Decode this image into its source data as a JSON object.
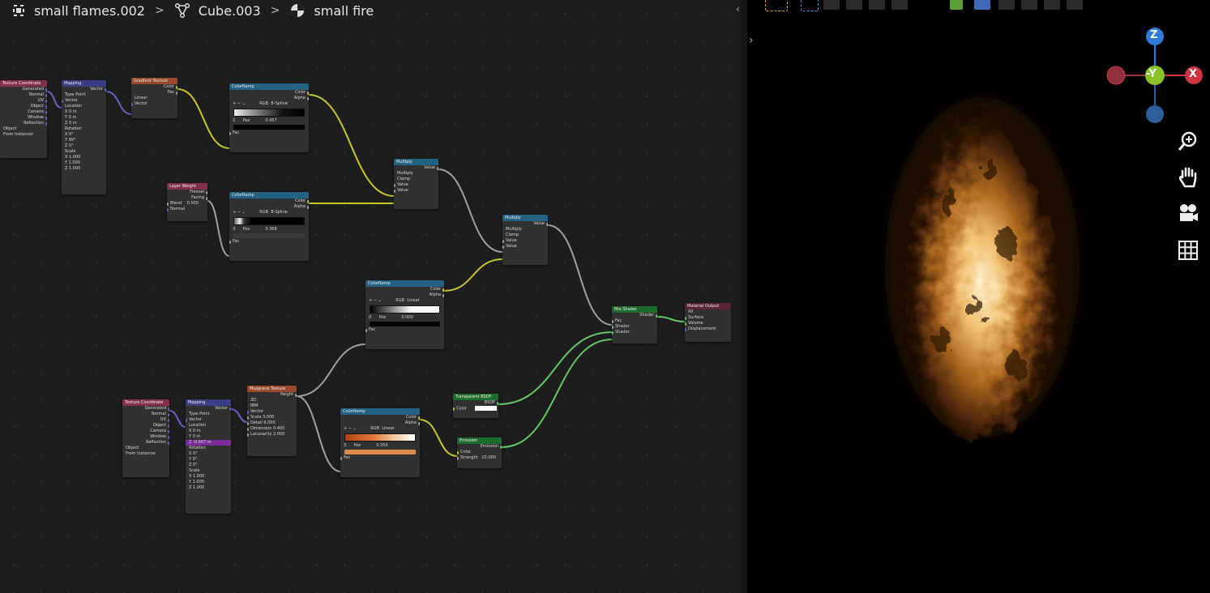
{
  "breadcrumbs": {
    "object": "small flames.002",
    "mesh": "Cube.003",
    "material": "small fire"
  },
  "nodes": {
    "tc1": {
      "title": "Texture Coordinate",
      "outs": [
        "Generated",
        "Normal",
        "UV",
        "Object",
        "Camera",
        "Window",
        "Reflection"
      ],
      "object": "Object",
      "from_instancer": "From Instancer"
    },
    "map1": {
      "title": "Mapping",
      "out": "Vector",
      "type_label": "Type",
      "type_val": "Point",
      "vec": "Vector",
      "loc": "Location",
      "loc_vals": [
        "X 0 m",
        "Y 0 m",
        "Z 0 m"
      ],
      "rot": "Rotation",
      "rot_vals": [
        "X 0°",
        "Y 90°",
        "Z 0°"
      ],
      "scale": "Scale",
      "scale_vals": [
        "X 1.000",
        "Y 1.000",
        "Z 1.000"
      ]
    },
    "grad": {
      "title": "Gradient Texture",
      "outs": [
        "Color",
        "Fac"
      ],
      "mode": "Linear",
      "in": "Vector"
    },
    "cr1": {
      "title": "ColorRamp",
      "outs": [
        "Color",
        "Alpha"
      ],
      "mode": "RGB",
      "interp": "B-Spline",
      "idx": "2",
      "pos_label": "Pos",
      "pos_val": "0.457",
      "in": "Fac"
    },
    "lw": {
      "title": "Layer Weight",
      "outs": [
        "Fresnel",
        "Facing"
      ],
      "blend": "Blend",
      "blend_val": "0.500",
      "in": "Normal"
    },
    "cr2": {
      "title": "ColorRamp",
      "outs": [
        "Color",
        "Alpha"
      ],
      "mode": "RGB",
      "interp": "B-Spline",
      "idx": "3",
      "pos_label": "Pos",
      "pos_val": "0.368",
      "in": "Fac"
    },
    "mul1": {
      "title": "Multiply",
      "out": "Value",
      "op": "Multiply",
      "clamp": "Clamp",
      "ins": [
        "Value",
        "Value"
      ]
    },
    "mul2": {
      "title": "Multiply",
      "out": "Value",
      "op": "Multiply",
      "clamp": "Clamp",
      "ins": [
        "Value",
        "Value"
      ]
    },
    "cr3": {
      "title": "ColorRamp",
      "outs": [
        "Color",
        "Alpha"
      ],
      "mode": "RGB",
      "interp": "Linear",
      "idx": "0",
      "pos_label": "Pos",
      "pos_val": "0.000",
      "in": "Fac"
    },
    "mix": {
      "title": "Mix Shader",
      "out": "Shader",
      "ins": [
        "Fac",
        "Shader",
        "Shader"
      ]
    },
    "out": {
      "title": "Material Output",
      "target": "All",
      "ins": [
        "Surface",
        "Volume",
        "Displacement"
      ]
    },
    "tc2": {
      "title": "Texture Coordinate",
      "outs": [
        "Generated",
        "Normal",
        "UV",
        "Object",
        "Camera",
        "Window",
        "Reflection"
      ],
      "object": "Object",
      "from_instancer": "From Instancer"
    },
    "map2": {
      "title": "Mapping",
      "out": "Vector",
      "type_label": "Type",
      "type_val": "Point",
      "vec": "Vector",
      "loc": "Location",
      "loc_vals": [
        "X 0 m",
        "Y 0 m",
        "Z -0.607 m"
      ],
      "rot": "Rotation",
      "rot_vals": [
        "X 0°",
        "Y 0°",
        "Z 0°"
      ],
      "scale": "Scale",
      "scale_vals": [
        "X 1.000",
        "Y 1.000",
        "Z 1.000"
      ]
    },
    "musg": {
      "title": "Musgrave Texture",
      "out": "Height",
      "dim": "3D",
      "kind": "fBM",
      "in": "Vector",
      "params": [
        "Scale 3.000",
        "Detail 6.000",
        "Dimension 0.400",
        "Lacunarity 2.000"
      ]
    },
    "cr4": {
      "title": "ColorRamp",
      "outs": [
        "Color",
        "Alpha"
      ],
      "mode": "RGB",
      "interp": "Linear",
      "idx": "3",
      "pos_label": "Pos",
      "pos_val": "0.550",
      "in": "Fac"
    },
    "trans": {
      "title": "Transparent BSDF",
      "out": "BSDF",
      "in": "Color"
    },
    "emis": {
      "title": "Emission",
      "out": "Emission",
      "ins": [
        "Color",
        "Strength"
      ],
      "strength": "15.000"
    }
  },
  "gizmo": {
    "z": "Z",
    "x": "X",
    "y": "-Y"
  },
  "colors": {
    "x": "#d0343f",
    "y": "#88c426",
    "z": "#2f7cd6",
    "node_bg": "#303030",
    "wire_color": "#c7c729",
    "wire_shader": "#63c763"
  }
}
